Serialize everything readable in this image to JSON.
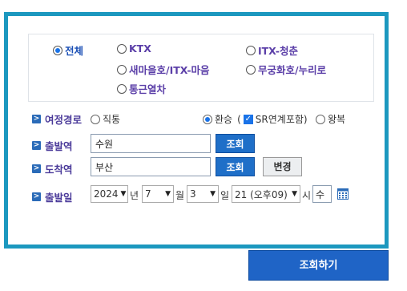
{
  "train_types": {
    "all": "전체",
    "ktx": "KTX",
    "itx_cheongchun": "ITX-청춘",
    "saemaeul": "새마을호/ITX-마음",
    "mugunghwa": "무궁화호/누리로",
    "commuter": "통근열차"
  },
  "route": {
    "label": "여정경로",
    "direct": "직통",
    "transfer": "환승",
    "sr_prefix": "(",
    "sr_link": "SR연계포함)",
    "round_trip": "왕복"
  },
  "departure": {
    "label": "출발역",
    "value": "수원",
    "search_label": "조회"
  },
  "arrival": {
    "label": "도착역",
    "value": "부산",
    "search_label": "조회",
    "swap_label": "변경"
  },
  "date": {
    "label": "출발일",
    "year": "2024",
    "year_unit": "년",
    "month": "7",
    "month_unit": "월",
    "day": "3",
    "day_unit": "일",
    "hour": "21 (오후09)",
    "hour_unit": "시",
    "weekday": "수",
    "calendar_icon": "calendar-icon"
  },
  "submit_label": "조회하기",
  "colors": {
    "panel_border": "#1c98bf",
    "button_blue": "#1f6fc8",
    "label_purple": "#4b3b9a"
  }
}
